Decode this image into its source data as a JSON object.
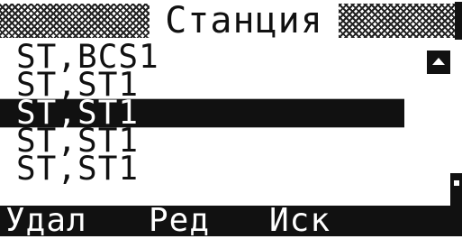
{
  "title": "Станция",
  "stations": [
    {
      "label": "ST,BCS1",
      "selected": false
    },
    {
      "label": "ST,ST1",
      "selected": false
    },
    {
      "label": "ST,ST1",
      "selected": true
    },
    {
      "label": "ST,ST1",
      "selected": false
    },
    {
      "label": "ST,ST1",
      "selected": false
    }
  ],
  "softkeys": {
    "delete": "Удал",
    "edit": "Ред",
    "search": "Иск"
  },
  "icons": {
    "scroll_up": "scroll-up-arrow-icon",
    "scroll_down": "scroll-down-icon"
  },
  "colors": {
    "foreground": "#111111",
    "background": "#ffffff",
    "selection": "#111111"
  }
}
